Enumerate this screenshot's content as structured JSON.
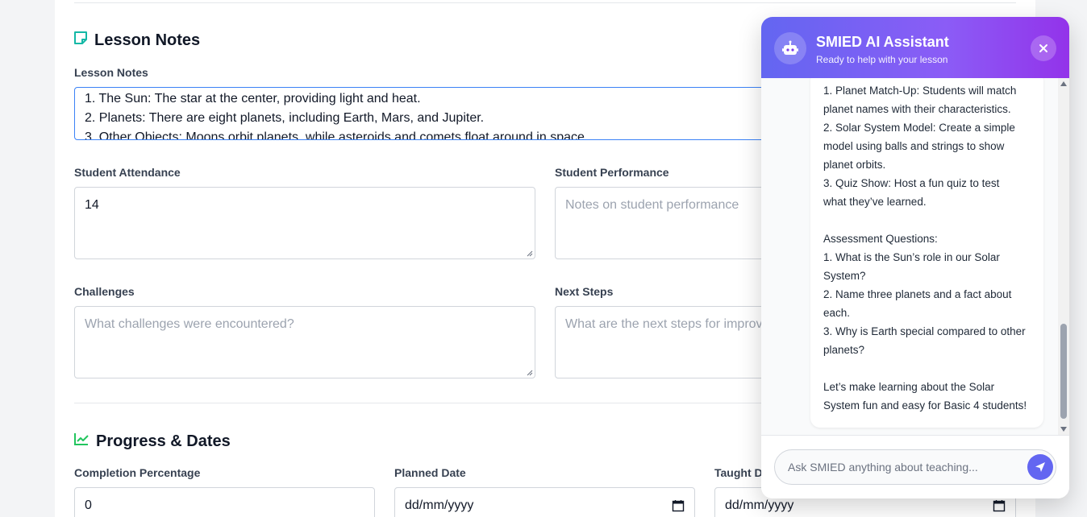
{
  "lesson_notes": {
    "section_title": "Lesson Notes",
    "label": "Lesson Notes",
    "lines": [
      "1. The Sun: The star at the center, providing light and heat.",
      "2. Planets: There are eight planets, including Earth, Mars, and Jupiter.",
      "3. Other Objects: Moons orbit planets, while asteroids and comets float around in space."
    ]
  },
  "attendance": {
    "label": "Student Attendance",
    "value": "14"
  },
  "performance": {
    "label": "Student Performance",
    "placeholder": "Notes on student performance"
  },
  "challenges": {
    "label": "Challenges",
    "placeholder": "What challenges were encountered?"
  },
  "next_steps": {
    "label": "Next Steps",
    "placeholder": "What are the next steps for improv"
  },
  "progress": {
    "section_title": "Progress & Dates",
    "completion_label": "Completion Percentage",
    "completion_value": "0",
    "planned_label": "Planned Date",
    "planned_value": "dd/mm/yyyy",
    "taught_label": "Taught D",
    "taught_value": "dd/mm/yyyy"
  },
  "chat": {
    "title": "SMIED AI Assistant",
    "subtitle": "Ready to help with your lesson",
    "message_lines": [
      "1. Planet Match-Up: Students will match",
      "planet names with their characteristics.",
      "2. Solar System Model: Create a simple",
      "model using balls and strings to show",
      "planet orbits.",
      "3. Quiz Show: Host a fun quiz to test",
      "what they’ve learned.",
      "",
      "Assessment Questions:",
      "1. What is the Sun’s role in our Solar",
      "System?",
      "2. Name three planets and a fact about",
      "each.",
      "3. Why is Earth special compared to other",
      "planets?",
      "",
      "Let’s make learning about the Solar",
      "System fun and easy for Basic 4 students!"
    ],
    "input_placeholder": "Ask SMIED anything about teaching..."
  },
  "colors": {
    "accent_teal": "#14b8a6",
    "accent_green": "#22c55e",
    "chat_gradient_start": "#6366f1",
    "chat_gradient_end": "#9333ea",
    "focus_border": "#3b82f6"
  }
}
